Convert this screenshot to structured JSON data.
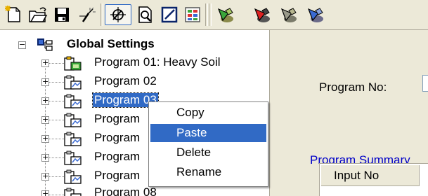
{
  "toolbar": {
    "buttons": [
      {
        "icon": "new-document-icon"
      },
      {
        "icon": "open-folder-icon"
      },
      {
        "icon": "save-disk-icon"
      },
      {
        "icon": "sprinkler-wand-icon"
      },
      {
        "icon": "sprinkler-select-icon",
        "pressed": true
      },
      {
        "icon": "print-preview-icon"
      },
      {
        "icon": "edit-field-icon"
      },
      {
        "icon": "grid-view-icon"
      },
      {
        "icon": "send-green-icon"
      },
      {
        "icon": "send-red-icon"
      },
      {
        "icon": "send-gray-icon"
      },
      {
        "icon": "send-blue-icon"
      }
    ]
  },
  "tree": {
    "root": {
      "label": "Global Settings",
      "expander": "−",
      "icon": "global-settings-icon"
    },
    "nodes": [
      {
        "label": "Program 01: Heavy Soil",
        "expander": "+",
        "icon": "program-active-icon"
      },
      {
        "label": "Program 02",
        "expander": "+",
        "icon": "program-icon"
      },
      {
        "label": "Program 03",
        "expander": "+",
        "icon": "program-icon",
        "selected": true
      },
      {
        "label": "Program",
        "expander": "+",
        "icon": "program-icon"
      },
      {
        "label": "Program",
        "expander": "+",
        "icon": "program-icon"
      },
      {
        "label": "Program",
        "expander": "+",
        "icon": "program-icon"
      },
      {
        "label": "Program",
        "expander": "+",
        "icon": "program-icon"
      },
      {
        "label": "Program 08",
        "expander": "+",
        "icon": "program-icon"
      }
    ]
  },
  "context_menu": {
    "items": [
      {
        "label": "Copy"
      },
      {
        "label": "Paste",
        "highlighted": true
      },
      {
        "label": "Delete"
      },
      {
        "label": "Rename"
      }
    ]
  },
  "details": {
    "program_no_label": "Program No:",
    "program_summary_label": "Program Summary",
    "table": {
      "columns": [
        "Input No"
      ]
    }
  },
  "colors": {
    "selection": "#316ac5",
    "panel_background": "#ece9d8",
    "link_text": "#0000c8"
  }
}
